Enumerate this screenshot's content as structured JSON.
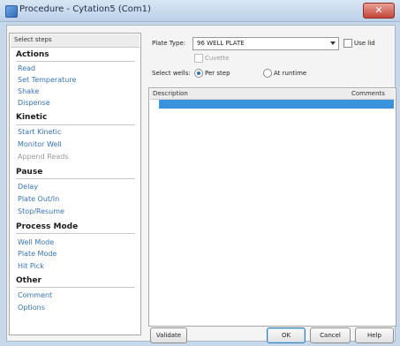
{
  "window": {
    "title": "Procedure - Cytation5 (Com1)"
  },
  "steps": {
    "header": "Select steps",
    "categories": [
      {
        "label": "Actions",
        "items": [
          {
            "label": "Read",
            "enabled": true
          },
          {
            "label": "Set Temperature",
            "enabled": true
          },
          {
            "label": "Shake",
            "enabled": true
          },
          {
            "label": "Dispense",
            "enabled": true
          }
        ]
      },
      {
        "label": "Kinetic",
        "items": [
          {
            "label": "Start Kinetic",
            "enabled": true
          },
          {
            "label": "Monitor Well",
            "enabled": true
          },
          {
            "label": "Append Reads",
            "enabled": false
          }
        ]
      },
      {
        "label": "Pause",
        "items": [
          {
            "label": "Delay",
            "enabled": true
          },
          {
            "label": "Plate Out/In",
            "enabled": true
          },
          {
            "label": "Stop/Resume",
            "enabled": true
          }
        ]
      },
      {
        "label": "Process Mode",
        "items": [
          {
            "label": "Well Mode",
            "enabled": true
          },
          {
            "label": "Plate Mode",
            "enabled": true
          },
          {
            "label": "Hit Pick",
            "enabled": true
          }
        ]
      },
      {
        "label": "Other",
        "items": [
          {
            "label": "Comment",
            "enabled": true
          },
          {
            "label": "Options",
            "enabled": true
          }
        ]
      }
    ]
  },
  "settings": {
    "plate_type_label": "Plate Type:",
    "plate_type_value": "96 WELL PLATE",
    "use_lid_label": "Use lid",
    "use_lid_checked": false,
    "cuvette_label": "Cuvette",
    "cuvette_checked": false,
    "select_wells_label": "Select wells:",
    "per_step_label": "Per step",
    "at_runtime_label": "At runtime",
    "select_wells_selected": "Per step"
  },
  "grid": {
    "col_description": "Description",
    "col_comments": "Comments"
  },
  "footer": {
    "validate": "Validate",
    "ok": "OK",
    "cancel": "Cancel",
    "help": "Help"
  },
  "colors": {
    "link": "#3973b3",
    "selection": "#3a92dc",
    "close_button": "#c4463a"
  },
  "icons": [
    "app-icon",
    "close-icon",
    "chevron-down-icon"
  ]
}
